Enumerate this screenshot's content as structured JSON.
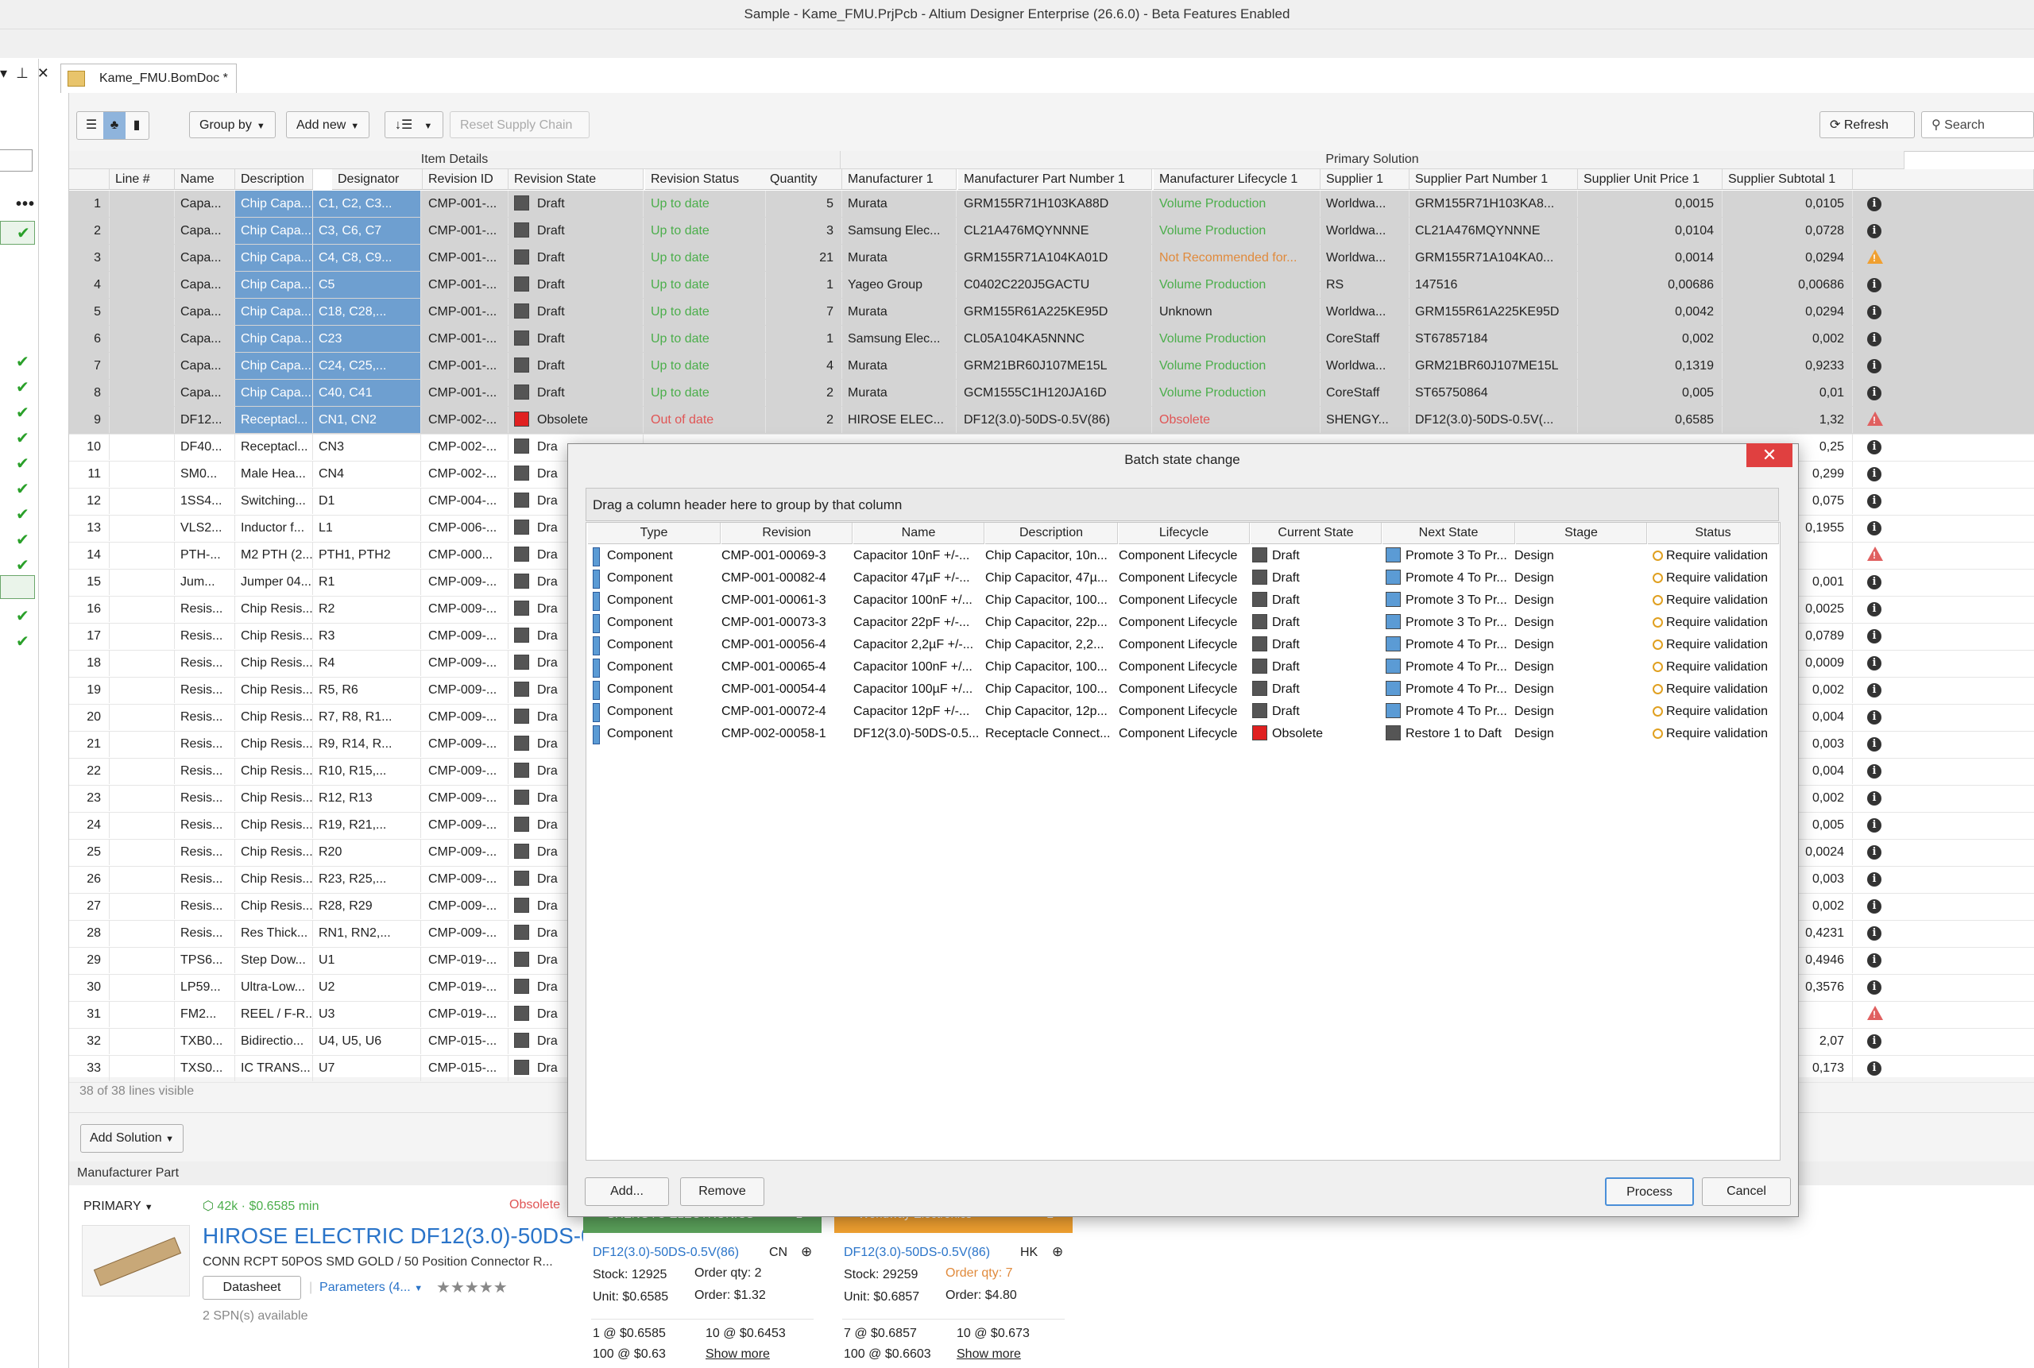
{
  "window": {
    "title": "Sample - Kame_FMU.PrjPcb - Altium Designer Enterprise (26.6.0) - Beta Features Enabled"
  },
  "document_tab": {
    "label": "Kame_FMU.BomDoc *"
  },
  "toolbar": {
    "group_by": "Group by",
    "add_new": "Add new",
    "reset_supply_chain": "Reset Supply Chain",
    "refresh": "Refresh",
    "search_placeholder": "Search"
  },
  "grid": {
    "group_headers": [
      "Item Details",
      "Primary Solution"
    ],
    "columns": [
      "Line #",
      "Name",
      "Description",
      "Designator",
      "Revision ID",
      "Revision State",
      "Revision Status",
      "Quantity",
      "Manufacturer 1",
      "Manufacturer Part Number 1",
      "Manufacturer Lifecycle 1",
      "Supplier 1",
      "Supplier Part Number 1",
      "Supplier Unit Price 1",
      "Supplier Subtotal 1"
    ],
    "rows": [
      {
        "n": "1",
        "name": "Capa...",
        "desc": "Chip Capa...",
        "des": "C1, C2, C3...",
        "rid": "CMP-001-...",
        "state": "Draft",
        "scolor": "#555555",
        "status": "Up to date",
        "qty": "5",
        "mfr": "Murata",
        "mpn": "GRM155R71H103KA88D",
        "life": "Volume Production",
        "sup": "Worldwa...",
        "spn": "GRM155R71H103KA8...",
        "unit": "0,0015",
        "sub": "0,0105",
        "icon": "info"
      },
      {
        "n": "2",
        "name": "Capa...",
        "desc": "Chip Capa...",
        "des": "C3, C6, C7",
        "rid": "CMP-001-...",
        "state": "Draft",
        "scolor": "#555555",
        "status": "Up to date",
        "qty": "3",
        "mfr": "Samsung Elec...",
        "mpn": "CL21A476MQYNNNE",
        "life": "Volume Production",
        "sup": "Worldwa...",
        "spn": "CL21A476MQYNNNE",
        "unit": "0,0104",
        "sub": "0,0728",
        "icon": "info"
      },
      {
        "n": "3",
        "name": "Capa...",
        "desc": "Chip Capa...",
        "des": "C4, C8, C9...",
        "rid": "CMP-001-...",
        "state": "Draft",
        "scolor": "#555555",
        "status": "Up to date",
        "qty": "21",
        "mfr": "Murata",
        "mpn": "GRM155R71A104KA01D",
        "life": "Not Recommended for...",
        "sup": "Worldwa...",
        "spn": "GRM155R71A104KA0...",
        "unit": "0,0014",
        "sub": "0,0294",
        "icon": "warn-o"
      },
      {
        "n": "4",
        "name": "Capa...",
        "desc": "Chip Capa...",
        "des": "C5",
        "rid": "CMP-001-...",
        "state": "Draft",
        "scolor": "#555555",
        "status": "Up to date",
        "qty": "1",
        "mfr": "Yageo Group",
        "mpn": "C0402C220J5GACTU",
        "life": "Volume Production",
        "sup": "RS",
        "spn": "147516",
        "unit": "0,00686",
        "sub": "0,00686",
        "icon": "info"
      },
      {
        "n": "5",
        "name": "Capa...",
        "desc": "Chip Capa...",
        "des": "C18, C28,...",
        "rid": "CMP-001-...",
        "state": "Draft",
        "scolor": "#555555",
        "status": "Up to date",
        "qty": "7",
        "mfr": "Murata",
        "mpn": "GRM155R61A225KE95D",
        "life": "Unknown",
        "sup": "Worldwa...",
        "spn": "GRM155R61A225KE95D",
        "unit": "0,0042",
        "sub": "0,0294",
        "icon": "info"
      },
      {
        "n": "6",
        "name": "Capa...",
        "desc": "Chip Capa...",
        "des": "C23",
        "rid": "CMP-001-...",
        "state": "Draft",
        "scolor": "#555555",
        "status": "Up to date",
        "qty": "1",
        "mfr": "Samsung Elec...",
        "mpn": "CL05A104KA5NNNC",
        "life": "Volume Production",
        "sup": "CoreStaff",
        "spn": "ST67857184",
        "unit": "0,002",
        "sub": "0,002",
        "icon": "info"
      },
      {
        "n": "7",
        "name": "Capa...",
        "desc": "Chip Capa...",
        "des": "C24, C25,...",
        "rid": "CMP-001-...",
        "state": "Draft",
        "scolor": "#555555",
        "status": "Up to date",
        "qty": "4",
        "mfr": "Murata",
        "mpn": "GRM21BR60J107ME15L",
        "life": "Volume Production",
        "sup": "Worldwa...",
        "spn": "GRM21BR60J107ME15L",
        "unit": "0,1319",
        "sub": "0,9233",
        "icon": "info"
      },
      {
        "n": "8",
        "name": "Capa...",
        "desc": "Chip Capa...",
        "des": "C40, C41",
        "rid": "CMP-001-...",
        "state": "Draft",
        "scolor": "#555555",
        "status": "Up to date",
        "qty": "2",
        "mfr": "Murata",
        "mpn": "GCM1555C1H120JA16D",
        "life": "Volume Production",
        "sup": "CoreStaff",
        "spn": "ST65750864",
        "unit": "0,005",
        "sub": "0,01",
        "icon": "info"
      },
      {
        "n": "9",
        "name": "DF12...",
        "desc": "Receptacl...",
        "des": "CN1, CN2",
        "rid": "CMP-002-...",
        "state": "Obsolete",
        "scolor": "#e02020",
        "status": "Out of date",
        "qty": "2",
        "mfr": "HIROSE ELEC...",
        "mpn": "DF12(3.0)-50DS-0.5V(86)",
        "life": "Obsolete",
        "sup": "SHENGY...",
        "spn": "DF12(3.0)-50DS-0.5V(...",
        "unit": "0,6585",
        "sub": "1,32",
        "icon": "warn-r"
      },
      {
        "n": "10",
        "name": "DF40...",
        "desc": "Receptacl...",
        "des": "CN3",
        "rid": "CMP-002-...",
        "state": "Dra",
        "sub": "0,25",
        "icon": "info"
      },
      {
        "n": "11",
        "name": "SM0...",
        "desc": "Male Hea...",
        "des": "CN4",
        "rid": "CMP-002-...",
        "state": "Dra",
        "sub": "0,299",
        "icon": "info"
      },
      {
        "n": "12",
        "name": "1SS4...",
        "desc": "Switching...",
        "des": "D1",
        "rid": "CMP-004-...",
        "state": "Dra",
        "sub": "0,075",
        "icon": "info"
      },
      {
        "n": "13",
        "name": "VLS2...",
        "desc": "Inductor f...",
        "des": "L1",
        "rid": "CMP-006-...",
        "state": "Dra",
        "sub": "0,1955",
        "icon": "info"
      },
      {
        "n": "14",
        "name": "PTH-...",
        "desc": "M2 PTH (2...",
        "des": "PTH1, PTH2",
        "rid": "CMP-000...",
        "state": "Dra",
        "sub": "",
        "icon": "warn-r"
      },
      {
        "n": "15",
        "name": "Jum...",
        "desc": "Jumper 04...",
        "des": "R1",
        "rid": "CMP-009-...",
        "state": "Dra",
        "sub": "0,001",
        "icon": "info"
      },
      {
        "n": "16",
        "name": "Resis...",
        "desc": "Chip Resis...",
        "des": "R2",
        "rid": "CMP-009-...",
        "state": "Dra",
        "sub": "0,0025",
        "icon": "info"
      },
      {
        "n": "17",
        "name": "Resis...",
        "desc": "Chip Resis...",
        "des": "R3",
        "rid": "CMP-009-...",
        "state": "Dra",
        "sub": "0,0789",
        "icon": "info"
      },
      {
        "n": "18",
        "name": "Resis...",
        "desc": "Chip Resis...",
        "des": "R4",
        "rid": "CMP-009-...",
        "state": "Dra",
        "sub": "0,0009",
        "icon": "info"
      },
      {
        "n": "19",
        "name": "Resis...",
        "desc": "Chip Resis...",
        "des": "R5, R6",
        "rid": "CMP-009-...",
        "state": "Dra",
        "sub": "0,002",
        "icon": "info"
      },
      {
        "n": "20",
        "name": "Resis...",
        "desc": "Chip Resis...",
        "des": "R7, R8, R1...",
        "rid": "CMP-009-...",
        "state": "Dra",
        "sub": "0,004",
        "icon": "info"
      },
      {
        "n": "21",
        "name": "Resis...",
        "desc": "Chip Resis...",
        "des": "R9, R14, R...",
        "rid": "CMP-009-...",
        "state": "Dra",
        "sub": "0,003",
        "icon": "info"
      },
      {
        "n": "22",
        "name": "Resis...",
        "desc": "Chip Resis...",
        "des": "R10, R15,...",
        "rid": "CMP-009-...",
        "state": "Dra",
        "sub": "0,004",
        "icon": "info"
      },
      {
        "n": "23",
        "name": "Resis...",
        "desc": "Chip Resis...",
        "des": "R12, R13",
        "rid": "CMP-009-...",
        "state": "Dra",
        "sub": "0,002",
        "icon": "info"
      },
      {
        "n": "24",
        "name": "Resis...",
        "desc": "Chip Resis...",
        "des": "R19, R21,...",
        "rid": "CMP-009-...",
        "state": "Dra",
        "sub": "0,005",
        "icon": "info"
      },
      {
        "n": "25",
        "name": "Resis...",
        "desc": "Chip Resis...",
        "des": "R20",
        "rid": "CMP-009-...",
        "state": "Dra",
        "sub": "0,0024",
        "icon": "info"
      },
      {
        "n": "26",
        "name": "Resis...",
        "desc": "Chip Resis...",
        "des": "R23, R25,...",
        "rid": "CMP-009-...",
        "state": "Dra",
        "sub": "0,003",
        "icon": "info"
      },
      {
        "n": "27",
        "name": "Resis...",
        "desc": "Chip Resis...",
        "des": "R28, R29",
        "rid": "CMP-009-...",
        "state": "Dra",
        "sub": "0,002",
        "icon": "info"
      },
      {
        "n": "28",
        "name": "Resis...",
        "desc": "Res Thick...",
        "des": "RN1, RN2,...",
        "rid": "CMP-009-...",
        "state": "Dra",
        "sub": "0,4231",
        "icon": "info"
      },
      {
        "n": "29",
        "name": "TPS6...",
        "desc": "Step Dow...",
        "des": "U1",
        "rid": "CMP-019-...",
        "state": "Dra",
        "sub": "0,4946",
        "icon": "info"
      },
      {
        "n": "30",
        "name": "LP59...",
        "desc": "Ultra-Low...",
        "des": "U2",
        "rid": "CMP-019-...",
        "state": "Dra",
        "sub": "0,3576",
        "icon": "info"
      },
      {
        "n": "31",
        "name": "FM2...",
        "desc": "REEL / F-R...",
        "des": "U3",
        "rid": "CMP-019-...",
        "state": "Dra",
        "sub": "",
        "icon": "warn-r"
      },
      {
        "n": "32",
        "name": "TXB0...",
        "desc": "Bidirectio...",
        "des": "U4, U5, U6",
        "rid": "CMP-015-...",
        "state": "Dra",
        "sub": "2,07",
        "icon": "info"
      },
      {
        "n": "33",
        "name": "TXS0...",
        "desc": "IC TRANS...",
        "des": "U7",
        "rid": "CMP-015-...",
        "state": "Dra",
        "sub": "0,173",
        "icon": "info"
      }
    ],
    "footer": "38 of 38 lines visible"
  },
  "solution_bar": {
    "add_solution": "Add Solution"
  },
  "manufacturer_panel": {
    "header": "Manufacturer Part",
    "primary": "PRIMARY",
    "stock_summary": "42k · $0.6585 min",
    "status": "Obsolete",
    "part_title": "HIROSE ELECTRIC DF12(3.0)-50DS-0.5",
    "part_desc": "CONN RCPT 50POS SMD GOLD / 50 Position Connector R...",
    "datasheet": "Datasheet",
    "parameters": "Parameters (4...",
    "stars": "★★★★★",
    "spn": "2 SPN(s) available"
  },
  "supplier_cards": [
    {
      "name": "SHENGYU ELECTRONICS",
      "count": "1",
      "part": "DF12(3.0)-50DS-0.5V(86)",
      "country": "CN",
      "stock": "Stock: 12925",
      "unit": "Unit: $0.6585",
      "order_qty": "Order qty: 2",
      "order": "Order: $1.32",
      "p1a": "1 @ $0.6585",
      "p1b": "10 @ $0.6453",
      "p2a": "100 @ $0.63",
      "more": "Show more",
      "color": "#5aa05a"
    },
    {
      "name": "Wondway Electronics",
      "count": "2",
      "part": "DF12(3.0)-50DS-0.5V(86)",
      "country": "HK",
      "stock": "Stock: 29259",
      "unit": "Unit: $0.6857",
      "order_qty": "Order qty: 7",
      "order": "Order: $4.80",
      "p1a": "7 @ $0.6857",
      "p1b": "10 @ $0.673",
      "p2a": "100 @ $0.6603",
      "more": "Show more",
      "color": "#f0a030"
    }
  ],
  "dialog": {
    "title": "Batch state change",
    "group_hint": "Drag a column header here to group by that column",
    "columns": [
      "Type",
      "Revision",
      "Name",
      "Description",
      "Lifecycle",
      "Current State",
      "Next State",
      "Stage",
      "Status"
    ],
    "rows": [
      {
        "type": "Component",
        "rev": "CMP-001-00069-3",
        "name": "Capacitor 10nF +/-...",
        "desc": "Chip Capacitor, 10n...",
        "life": "Component Lifecycle",
        "cur": "Draft",
        "curcolor": "#555555",
        "next": "Promote 3 To Pr...",
        "nextcolor": "#5b9bd5",
        "stage": "Design",
        "status": "Require validation"
      },
      {
        "type": "Component",
        "rev": "CMP-001-00082-4",
        "name": "Capacitor 47µF +/-...",
        "desc": "Chip Capacitor, 47µ...",
        "life": "Component Lifecycle",
        "cur": "Draft",
        "curcolor": "#555555",
        "next": "Promote 4 To Pr...",
        "nextcolor": "#5b9bd5",
        "stage": "Design",
        "status": "Require validation"
      },
      {
        "type": "Component",
        "rev": "CMP-001-00061-3",
        "name": "Capacitor 100nF +/...",
        "desc": "Chip Capacitor, 100...",
        "life": "Component Lifecycle",
        "cur": "Draft",
        "curcolor": "#555555",
        "next": "Promote 3 To Pr...",
        "nextcolor": "#5b9bd5",
        "stage": "Design",
        "status": "Require validation"
      },
      {
        "type": "Component",
        "rev": "CMP-001-00073-3",
        "name": "Capacitor 22pF +/-...",
        "desc": "Chip Capacitor, 22p...",
        "life": "Component Lifecycle",
        "cur": "Draft",
        "curcolor": "#555555",
        "next": "Promote 3 To Pr...",
        "nextcolor": "#5b9bd5",
        "stage": "Design",
        "status": "Require validation"
      },
      {
        "type": "Component",
        "rev": "CMP-001-00056-4",
        "name": "Capacitor 2,2µF +/-...",
        "desc": "Chip Capacitor, 2,2...",
        "life": "Component Lifecycle",
        "cur": "Draft",
        "curcolor": "#555555",
        "next": "Promote 4 To Pr...",
        "nextcolor": "#5b9bd5",
        "stage": "Design",
        "status": "Require validation"
      },
      {
        "type": "Component",
        "rev": "CMP-001-00065-4",
        "name": "Capacitor 100nF +/...",
        "desc": "Chip Capacitor, 100...",
        "life": "Component Lifecycle",
        "cur": "Draft",
        "curcolor": "#555555",
        "next": "Promote 4 To Pr...",
        "nextcolor": "#5b9bd5",
        "stage": "Design",
        "status": "Require validation"
      },
      {
        "type": "Component",
        "rev": "CMP-001-00054-4",
        "name": "Capacitor 100µF +/...",
        "desc": "Chip Capacitor, 100...",
        "life": "Component Lifecycle",
        "cur": "Draft",
        "curcolor": "#555555",
        "next": "Promote 4 To Pr...",
        "nextcolor": "#5b9bd5",
        "stage": "Design",
        "status": "Require validation"
      },
      {
        "type": "Component",
        "rev": "CMP-001-00072-4",
        "name": "Capacitor 12pF +/-...",
        "desc": "Chip Capacitor, 12p...",
        "life": "Component Lifecycle",
        "cur": "Draft",
        "curcolor": "#555555",
        "next": "Promote 4 To Pr...",
        "nextcolor": "#5b9bd5",
        "stage": "Design",
        "status": "Require validation"
      },
      {
        "type": "Component",
        "rev": "CMP-002-00058-1",
        "name": "DF12(3.0)-50DS-0.5...",
        "desc": "Receptacle Connect...",
        "life": "Component Lifecycle",
        "cur": "Obsolete",
        "curcolor": "#e02020",
        "next": "Restore 1 to Daft",
        "nextcolor": "#555555",
        "stage": "Design",
        "status": "Require validation"
      }
    ],
    "buttons": {
      "add": "Add...",
      "remove": "Remove",
      "process": "Process",
      "cancel": "Cancel"
    }
  }
}
